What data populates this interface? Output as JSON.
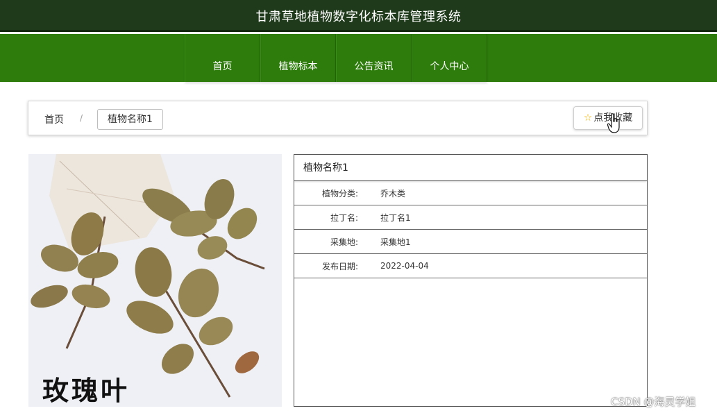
{
  "app": {
    "title": "甘肃草地植物数字化标本库管理系统"
  },
  "nav": {
    "items": [
      {
        "label": "首页"
      },
      {
        "label": "植物标本"
      },
      {
        "label": "公告资讯"
      },
      {
        "label": "个人中心"
      }
    ]
  },
  "breadcrumb": {
    "home": "首页",
    "separator": "/",
    "current": "植物名称1"
  },
  "favorite_button": {
    "label": "点我收藏",
    "icon": "star-icon"
  },
  "image": {
    "caption": "玫瑰叶"
  },
  "detail": {
    "title": "植物名称1",
    "rows": [
      {
        "label": "植物分类:",
        "value": "乔木类"
      },
      {
        "label": "拉丁名:",
        "value": "拉丁名1"
      },
      {
        "label": "采集地:",
        "value": "采集地1"
      },
      {
        "label": "发布日期:",
        "value": "2022-04-04"
      }
    ]
  },
  "watermark": "CSDN @海灵学姐",
  "colors": {
    "header_dark": "#1e3a1b",
    "nav_green": "#2e7d0c",
    "star": "#f0b400"
  }
}
